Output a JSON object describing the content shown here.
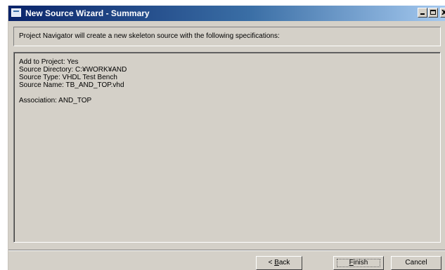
{
  "window": {
    "title": "New Source Wizard - Summary",
    "buttons": {
      "minimize_icon": "minimize-icon",
      "maximize_icon": "maximize-icon",
      "close_glyph": "x"
    }
  },
  "header": {
    "text": "Project Navigator will create a new skeleton source with the following specifications:"
  },
  "summary": {
    "add_to_project": "Add to Project: Yes",
    "source_directory": "Source Directory: C:¥WORK¥AND",
    "source_type": "Source Type: VHDL Test Bench",
    "source_name": "Source Name: TB_AND_TOP.vhd",
    "association": "Association: AND_TOP"
  },
  "footer": {
    "back": {
      "prefix": "< ",
      "accel": "B",
      "rest": "ack"
    },
    "finish": {
      "accel": "F",
      "rest": "inish"
    },
    "cancel": "Cancel"
  },
  "colors": {
    "face": "#d4d0c8",
    "title_start": "#0a246a",
    "title_end": "#a6caf0",
    "text": "#000000"
  }
}
